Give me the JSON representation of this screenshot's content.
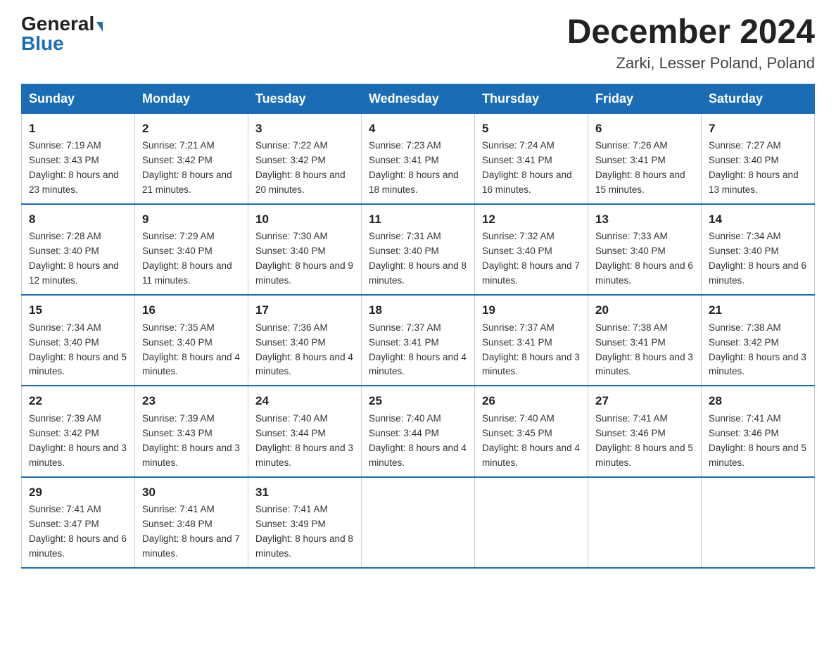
{
  "header": {
    "logo": {
      "general": "General",
      "blue": "Blue",
      "arrow": "▼"
    },
    "title": "December 2024",
    "subtitle": "Zarki, Lesser Poland, Poland"
  },
  "days_of_week": [
    "Sunday",
    "Monday",
    "Tuesday",
    "Wednesday",
    "Thursday",
    "Friday",
    "Saturday"
  ],
  "weeks": [
    [
      {
        "day": "1",
        "sunrise": "7:19 AM",
        "sunset": "3:43 PM",
        "daylight": "8 hours and 23 minutes."
      },
      {
        "day": "2",
        "sunrise": "7:21 AM",
        "sunset": "3:42 PM",
        "daylight": "8 hours and 21 minutes."
      },
      {
        "day": "3",
        "sunrise": "7:22 AM",
        "sunset": "3:42 PM",
        "daylight": "8 hours and 20 minutes."
      },
      {
        "day": "4",
        "sunrise": "7:23 AM",
        "sunset": "3:41 PM",
        "daylight": "8 hours and 18 minutes."
      },
      {
        "day": "5",
        "sunrise": "7:24 AM",
        "sunset": "3:41 PM",
        "daylight": "8 hours and 16 minutes."
      },
      {
        "day": "6",
        "sunrise": "7:26 AM",
        "sunset": "3:41 PM",
        "daylight": "8 hours and 15 minutes."
      },
      {
        "day": "7",
        "sunrise": "7:27 AM",
        "sunset": "3:40 PM",
        "daylight": "8 hours and 13 minutes."
      }
    ],
    [
      {
        "day": "8",
        "sunrise": "7:28 AM",
        "sunset": "3:40 PM",
        "daylight": "8 hours and 12 minutes."
      },
      {
        "day": "9",
        "sunrise": "7:29 AM",
        "sunset": "3:40 PM",
        "daylight": "8 hours and 11 minutes."
      },
      {
        "day": "10",
        "sunrise": "7:30 AM",
        "sunset": "3:40 PM",
        "daylight": "8 hours and 9 minutes."
      },
      {
        "day": "11",
        "sunrise": "7:31 AM",
        "sunset": "3:40 PM",
        "daylight": "8 hours and 8 minutes."
      },
      {
        "day": "12",
        "sunrise": "7:32 AM",
        "sunset": "3:40 PM",
        "daylight": "8 hours and 7 minutes."
      },
      {
        "day": "13",
        "sunrise": "7:33 AM",
        "sunset": "3:40 PM",
        "daylight": "8 hours and 6 minutes."
      },
      {
        "day": "14",
        "sunrise": "7:34 AM",
        "sunset": "3:40 PM",
        "daylight": "8 hours and 6 minutes."
      }
    ],
    [
      {
        "day": "15",
        "sunrise": "7:34 AM",
        "sunset": "3:40 PM",
        "daylight": "8 hours and 5 minutes."
      },
      {
        "day": "16",
        "sunrise": "7:35 AM",
        "sunset": "3:40 PM",
        "daylight": "8 hours and 4 minutes."
      },
      {
        "day": "17",
        "sunrise": "7:36 AM",
        "sunset": "3:40 PM",
        "daylight": "8 hours and 4 minutes."
      },
      {
        "day": "18",
        "sunrise": "7:37 AM",
        "sunset": "3:41 PM",
        "daylight": "8 hours and 4 minutes."
      },
      {
        "day": "19",
        "sunrise": "7:37 AM",
        "sunset": "3:41 PM",
        "daylight": "8 hours and 3 minutes."
      },
      {
        "day": "20",
        "sunrise": "7:38 AM",
        "sunset": "3:41 PM",
        "daylight": "8 hours and 3 minutes."
      },
      {
        "day": "21",
        "sunrise": "7:38 AM",
        "sunset": "3:42 PM",
        "daylight": "8 hours and 3 minutes."
      }
    ],
    [
      {
        "day": "22",
        "sunrise": "7:39 AM",
        "sunset": "3:42 PM",
        "daylight": "8 hours and 3 minutes."
      },
      {
        "day": "23",
        "sunrise": "7:39 AM",
        "sunset": "3:43 PM",
        "daylight": "8 hours and 3 minutes."
      },
      {
        "day": "24",
        "sunrise": "7:40 AM",
        "sunset": "3:44 PM",
        "daylight": "8 hours and 3 minutes."
      },
      {
        "day": "25",
        "sunrise": "7:40 AM",
        "sunset": "3:44 PM",
        "daylight": "8 hours and 4 minutes."
      },
      {
        "day": "26",
        "sunrise": "7:40 AM",
        "sunset": "3:45 PM",
        "daylight": "8 hours and 4 minutes."
      },
      {
        "day": "27",
        "sunrise": "7:41 AM",
        "sunset": "3:46 PM",
        "daylight": "8 hours and 5 minutes."
      },
      {
        "day": "28",
        "sunrise": "7:41 AM",
        "sunset": "3:46 PM",
        "daylight": "8 hours and 5 minutes."
      }
    ],
    [
      {
        "day": "29",
        "sunrise": "7:41 AM",
        "sunset": "3:47 PM",
        "daylight": "8 hours and 6 minutes."
      },
      {
        "day": "30",
        "sunrise": "7:41 AM",
        "sunset": "3:48 PM",
        "daylight": "8 hours and 7 minutes."
      },
      {
        "day": "31",
        "sunrise": "7:41 AM",
        "sunset": "3:49 PM",
        "daylight": "8 hours and 8 minutes."
      },
      null,
      null,
      null,
      null
    ]
  ]
}
